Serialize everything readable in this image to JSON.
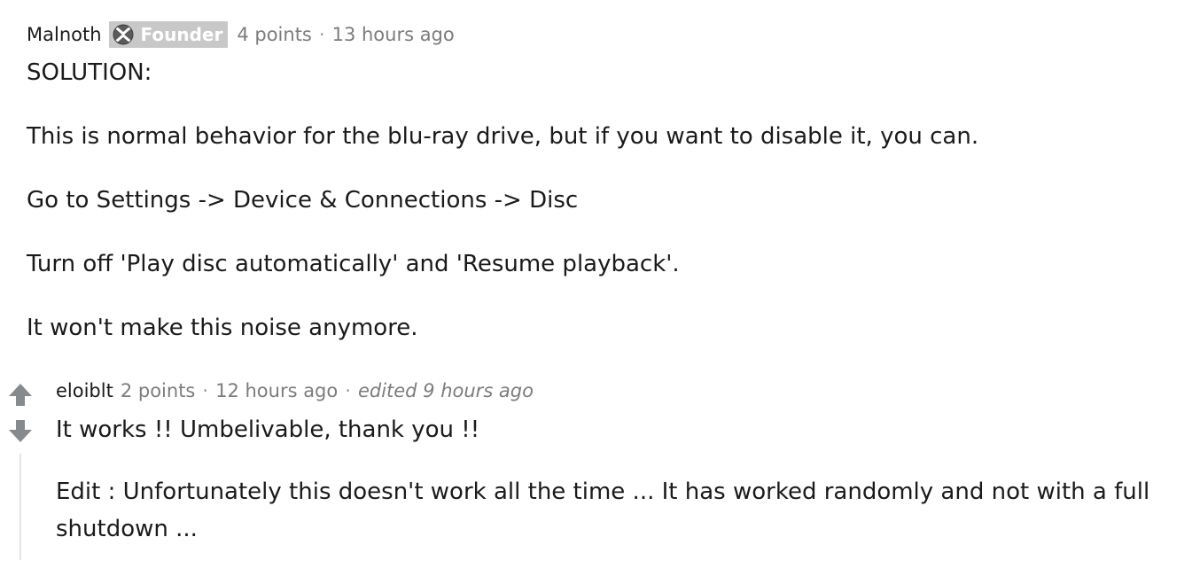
{
  "comment": {
    "author": "Malnoth",
    "flair": {
      "label": "Founder",
      "icon": "xbox-logo-icon"
    },
    "points": "4 points",
    "separator": "·",
    "time": "13 hours ago",
    "paragraphs": [
      "SOLUTION:",
      "This is normal behavior for the blu-ray drive, but if you want to disable it, you can.",
      "Go to Settings -> Device & Connections -> Disc",
      "Turn off 'Play disc automatically' and 'Resume playback'.",
      "It won't make this noise anymore."
    ]
  },
  "reply": {
    "upvote_icon": "up-arrow-icon",
    "downvote_icon": "down-arrow-icon",
    "author": "eloiblt",
    "points": "2 points",
    "separator": "·",
    "time": "12 hours ago",
    "edited": "edited 9 hours ago",
    "paragraphs": [
      "It works !! Umbelivable, thank you !!",
      "Edit : Unfortunately this doesn't work all the time ... It has worked randomly and not with a full shutdown ..."
    ]
  },
  "colors": {
    "text": "#1a1a1b",
    "meta": "#7c7c7c",
    "flair_bg": "#c8c8c8",
    "vote_arrow": "#878a8c",
    "thread_line": "#e5e5e5"
  }
}
